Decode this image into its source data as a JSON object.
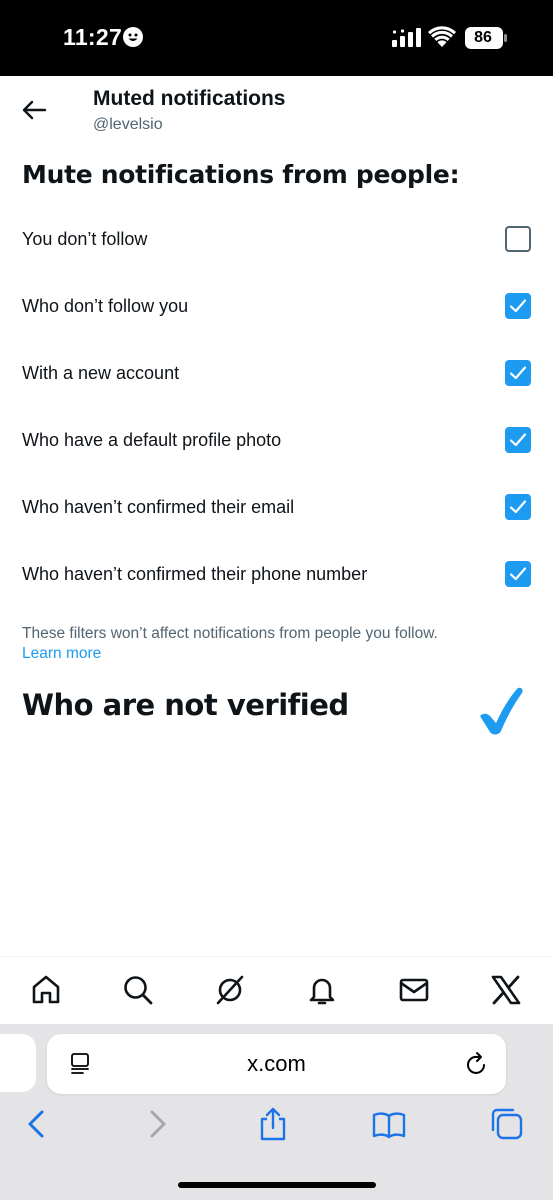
{
  "status_bar": {
    "time": "11:27",
    "battery": "86"
  },
  "header": {
    "title": "Muted notifications",
    "handle": "@levelsio"
  },
  "section_heading": "Mute notifications from people:",
  "options": [
    {
      "label": "You don’t follow",
      "checked": false
    },
    {
      "label": "Who don’t follow you",
      "checked": true
    },
    {
      "label": "With a new account",
      "checked": true
    },
    {
      "label": "Who have a default profile photo",
      "checked": true
    },
    {
      "label": "Who haven’t confirmed their email",
      "checked": true
    },
    {
      "label": "Who haven’t confirmed their phone number",
      "checked": true
    }
  ],
  "note": "These filters won’t affect notifications from people you follow.",
  "learn_more": "Learn more",
  "extra_option": {
    "label": "Who are not verified",
    "checked": true
  },
  "bottom_nav": [
    "home-icon",
    "search-icon",
    "grok-icon",
    "bell-icon",
    "mail-icon",
    "x-logo-icon"
  ],
  "browser": {
    "url": "x.com"
  },
  "colors": {
    "accent": "#1d9bf0",
    "text": "#0f1419",
    "secondary": "#536471"
  }
}
